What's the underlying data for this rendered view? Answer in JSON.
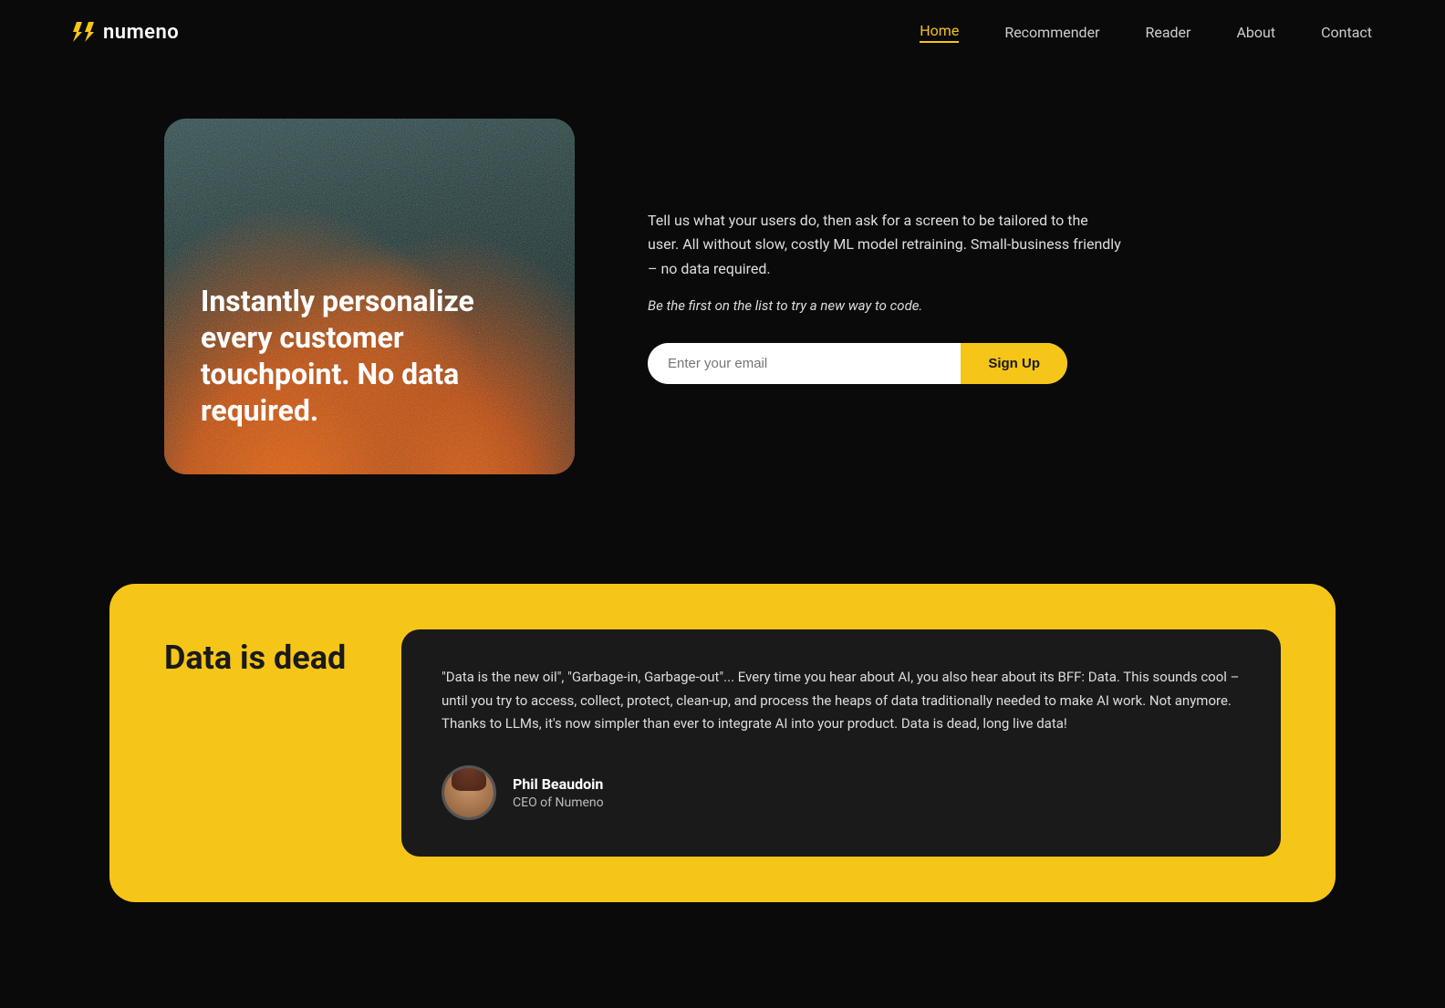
{
  "brand": {
    "name": "numeno",
    "logo_alt": "Numeno logo"
  },
  "nav": {
    "links": [
      {
        "label": "Home",
        "active": true
      },
      {
        "label": "Recommender",
        "active": false
      },
      {
        "label": "Reader",
        "active": false
      },
      {
        "label": "About",
        "active": false
      },
      {
        "label": "Contact",
        "active": false
      }
    ]
  },
  "hero": {
    "card_headline": "Instantly personalize every customer touchpoint. No data required.",
    "description": "Tell us what your users do, then ask for a screen to be tailored to the user.  All without slow, costly ML model retraining.  Small-business friendly – no data required.",
    "tagline": "Be the first on the list to try a new way to code.",
    "email_placeholder": "Enter your email",
    "signup_label": "Sign Up"
  },
  "data_section": {
    "title": "Data is dead",
    "quote": "\"Data is the new oil\", \"Garbage-in, Garbage-out\"... Every time you hear about AI, you also hear about its BFF: Data. This sounds cool – until you try to access, collect, protect, clean-up, and process the heaps of data traditionally needed to make AI work. Not anymore. Thanks to LLMs, it's now simpler than ever to integrate AI into your product. Data is dead, long live data!",
    "author_name": "Phil Beaudoin",
    "author_title": "CEO of Numeno"
  }
}
